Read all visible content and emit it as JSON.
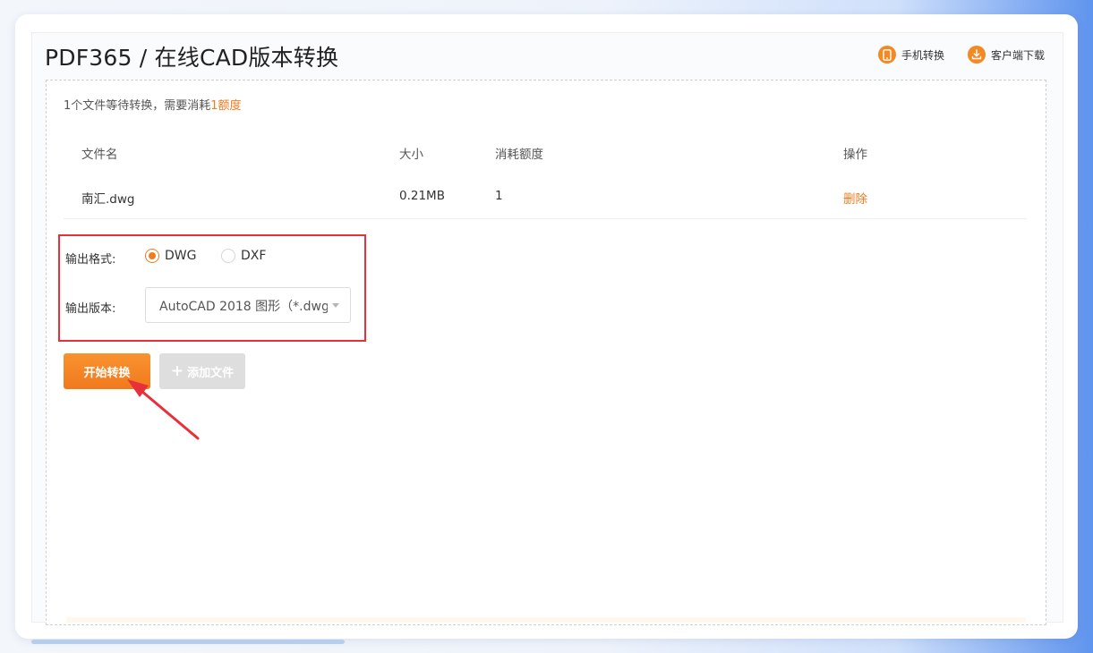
{
  "header": {
    "title": "PDF365 / 在线CAD版本转换",
    "mobile_convert": "手机转换",
    "client_download": "客户端下载"
  },
  "notice": {
    "prefix": "1个文件等待转换，需要消耗",
    "highlight": "1额度"
  },
  "table": {
    "columns": [
      "文件名",
      "大小",
      "消耗额度",
      "操作"
    ],
    "rows": [
      {
        "name": "南汇.dwg",
        "size": "0.21MB",
        "credits": "1",
        "action": "删除"
      }
    ]
  },
  "options": {
    "format_label": "输出格式:",
    "formats": [
      "DWG",
      "DXF"
    ],
    "selected_format": "DWG",
    "version_label": "输出版本:",
    "version_value": "AutoCAD 2018 图形（*.dwg"
  },
  "buttons": {
    "start": "开始转换",
    "add_file": "添加文件"
  },
  "colors": {
    "accent": "#f07b21",
    "highlight_box": "#e8303a"
  },
  "icons": [
    "phone-icon",
    "download-icon",
    "plus-icon",
    "caret-down-icon"
  ]
}
